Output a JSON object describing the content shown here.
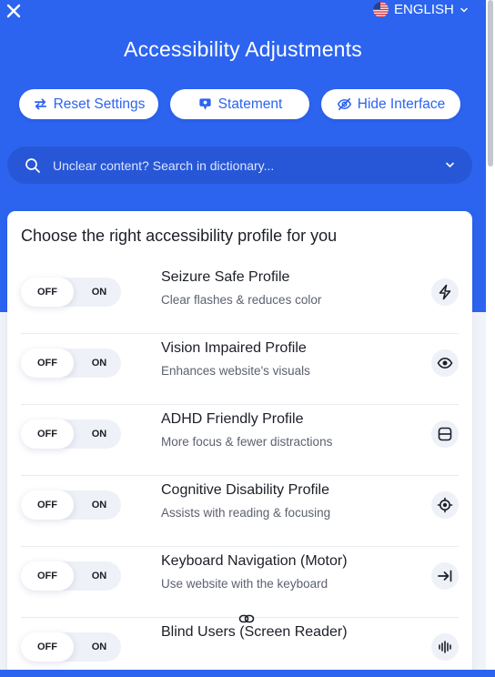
{
  "header": {
    "language": "ENGLISH",
    "title": "Accessibility Adjustments"
  },
  "actions": {
    "reset": "Reset Settings",
    "statement": "Statement",
    "hide": "Hide Interface"
  },
  "search": {
    "placeholder": "Unclear content? Search in dictionary..."
  },
  "card": {
    "title": "Choose the right accessibility profile for you"
  },
  "toggle_labels": {
    "off": "OFF",
    "on": "ON"
  },
  "profiles": [
    {
      "name": "Seizure Safe Profile",
      "desc": "Clear flashes & reduces color",
      "icon": "lightning-icon",
      "state": "off"
    },
    {
      "name": "Vision Impaired Profile",
      "desc": "Enhances website's visuals",
      "icon": "eye-icon",
      "state": "off"
    },
    {
      "name": "ADHD Friendly Profile",
      "desc": "More focus & fewer distractions",
      "icon": "focus-frame-icon",
      "state": "off"
    },
    {
      "name": "Cognitive Disability Profile",
      "desc": "Assists with reading & focusing",
      "icon": "target-icon",
      "state": "off"
    },
    {
      "name": "Keyboard Navigation (Motor)",
      "desc": "Use website with the keyboard",
      "icon": "arrow-to-line-icon",
      "state": "off"
    },
    {
      "name": "Blind Users (Screen Reader)",
      "desc": "",
      "icon": "audio-bars-icon",
      "state": "off"
    }
  ],
  "colors": {
    "brand": "#2c64f0",
    "search_bg": "#2757d6",
    "card_bg": "#ffffff",
    "text": "#1c1f27",
    "muted": "#5c6170"
  }
}
